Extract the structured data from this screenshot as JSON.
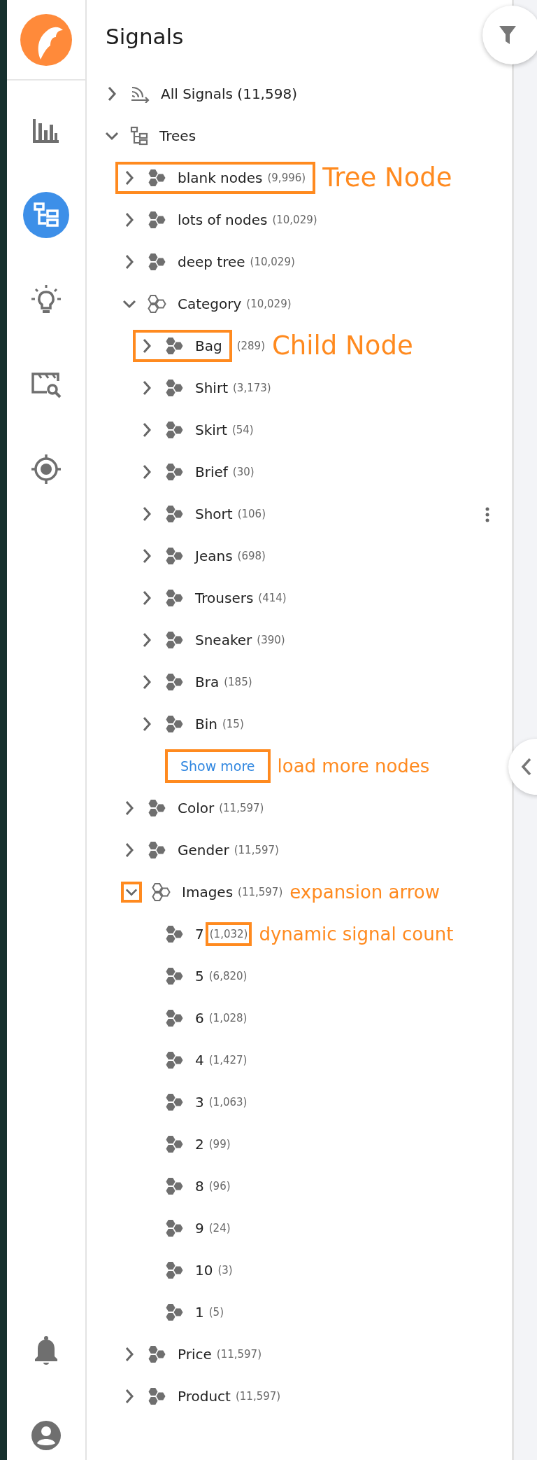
{
  "nav": {
    "top": [
      {
        "kind": "chart",
        "selected": false
      },
      {
        "kind": "trees",
        "selected": true
      },
      {
        "kind": "bulb",
        "selected": false
      },
      {
        "kind": "clapper-search",
        "selected": false
      },
      {
        "kind": "target",
        "selected": false
      }
    ],
    "bottom": [
      {
        "kind": "bell",
        "selected": false
      },
      {
        "kind": "user",
        "selected": false
      }
    ]
  },
  "panel": {
    "title": "Signals",
    "tree": [
      {
        "kind": "all",
        "label": "All Signals (11,598)",
        "expanded": false
      },
      {
        "kind": "trees",
        "label": "Trees",
        "expanded": true,
        "children": [
          {
            "kind": "group",
            "label": "blank nodes",
            "count": "(9,996)",
            "expanded": false,
            "note": {
              "text": "Tree Node",
              "kind": "row"
            }
          },
          {
            "kind": "group",
            "label": "lots of nodes",
            "count": "(10,029)",
            "expanded": false
          },
          {
            "kind": "group",
            "label": "deep tree",
            "count": "(10,029)",
            "expanded": false
          },
          {
            "kind": "group",
            "label": "Category",
            "count": "(10,029)",
            "expanded": true,
            "children": [
              {
                "kind": "group",
                "label": "Bag",
                "count": "(289)",
                "expanded": false,
                "note": {
                  "text": "Child Node",
                  "kind": "name"
                }
              },
              {
                "kind": "group",
                "label": "Shirt",
                "count": "(3,173)",
                "expanded": false
              },
              {
                "kind": "group",
                "label": "Skirt",
                "count": "(54)",
                "expanded": false
              },
              {
                "kind": "group",
                "label": "Brief",
                "count": "(30)",
                "expanded": false
              },
              {
                "kind": "group",
                "label": "Short",
                "count": "(106)",
                "expanded": false,
                "hovered": true
              },
              {
                "kind": "group",
                "label": "Jeans",
                "count": "(698)",
                "expanded": false
              },
              {
                "kind": "group",
                "label": "Trousers",
                "count": "(414)",
                "expanded": false
              },
              {
                "kind": "group",
                "label": "Sneaker",
                "count": "(390)",
                "expanded": false
              },
              {
                "kind": "group",
                "label": "Bra",
                "count": "(185)",
                "expanded": false
              },
              {
                "kind": "group",
                "label": "Bin",
                "count": "(15)",
                "expanded": false
              }
            ],
            "show_more": {
              "label": "Show more",
              "note": "load more nodes"
            }
          },
          {
            "kind": "group",
            "label": "Color",
            "count": "(11,597)",
            "expanded": false
          },
          {
            "kind": "group",
            "label": "Gender",
            "count": "(11,597)",
            "expanded": false
          },
          {
            "kind": "group",
            "label": "Images",
            "count": "(11,597)",
            "expanded": true,
            "note": {
              "text": "expansion arrow",
              "kind": "toggle"
            },
            "children": [
              {
                "kind": "leaf",
                "label": "7",
                "count": "(1,032)",
                "note": {
                  "text": "dynamic signal count",
                  "kind": "count"
                }
              },
              {
                "kind": "leaf",
                "label": "5",
                "count": "(6,820)"
              },
              {
                "kind": "leaf",
                "label": "6",
                "count": "(1,028)"
              },
              {
                "kind": "leaf",
                "label": "4",
                "count": "(1,427)"
              },
              {
                "kind": "leaf",
                "label": "3",
                "count": "(1,063)"
              },
              {
                "kind": "leaf",
                "label": "2",
                "count": "(99)"
              },
              {
                "kind": "leaf",
                "label": "8",
                "count": "(96)"
              },
              {
                "kind": "leaf",
                "label": "9",
                "count": "(24)"
              },
              {
                "kind": "leaf",
                "label": "10",
                "count": "(3)"
              },
              {
                "kind": "leaf",
                "label": "1",
                "count": "(5)"
              }
            ]
          },
          {
            "kind": "group",
            "label": "Price",
            "count": "(11,597)",
            "expanded": false
          },
          {
            "kind": "group",
            "label": "Product",
            "count": "(11,597)",
            "expanded": false
          }
        ]
      }
    ]
  }
}
